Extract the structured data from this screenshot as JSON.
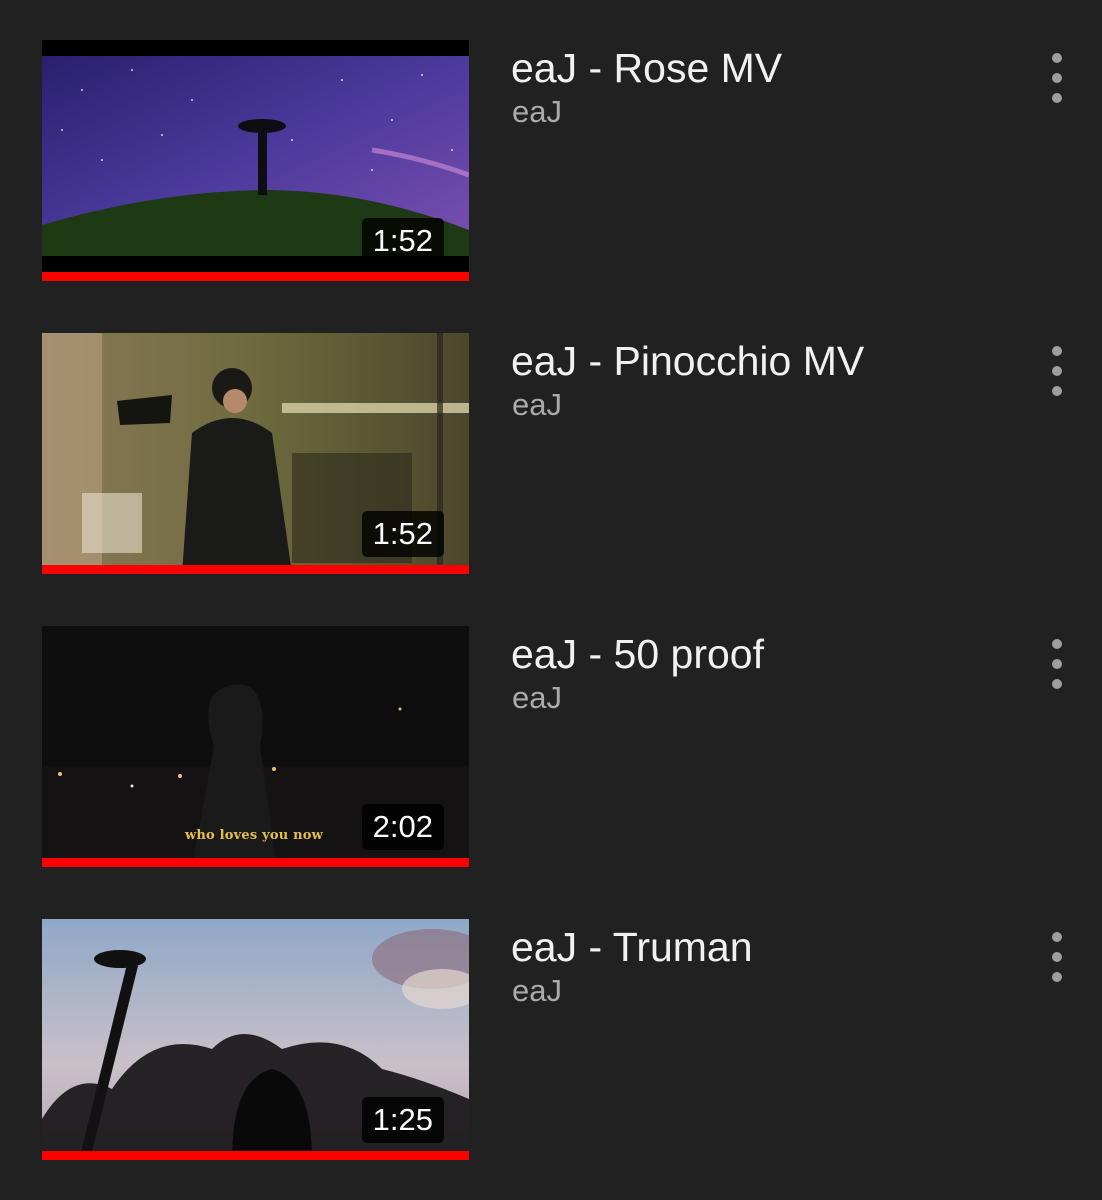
{
  "colors": {
    "background": "#212121",
    "title": "#f1f1f1",
    "channel": "#aaaaaa",
    "progress": "#ff0000",
    "menu_dots": "#9e9e9e"
  },
  "videos": [
    {
      "title": "eaJ - Rose MV",
      "channel": "eaJ",
      "duration": "1:52",
      "watched_fraction": 1.0,
      "thumbnail": "night-sky-baobab-tree",
      "menu_icon": "more-vert-icon"
    },
    {
      "title": "eaJ - Pinocchio MV",
      "channel": "eaJ",
      "duration": "1:52",
      "watched_fraction": 1.0,
      "thumbnail": "recording-booth-singer",
      "menu_icon": "more-vert-icon"
    },
    {
      "title": "eaJ - 50 proof",
      "channel": "eaJ",
      "duration": "2:02",
      "watched_fraction": 1.0,
      "thumbnail": "dark-hooded-figure-park",
      "thumbnail_caption": "who loves you now",
      "menu_icon": "more-vert-icon"
    },
    {
      "title": "eaJ - Truman",
      "channel": "eaJ",
      "duration": "1:25",
      "watched_fraction": 1.0,
      "thumbnail": "silhouette-streetlamp-trees",
      "menu_icon": "more-vert-icon"
    }
  ]
}
